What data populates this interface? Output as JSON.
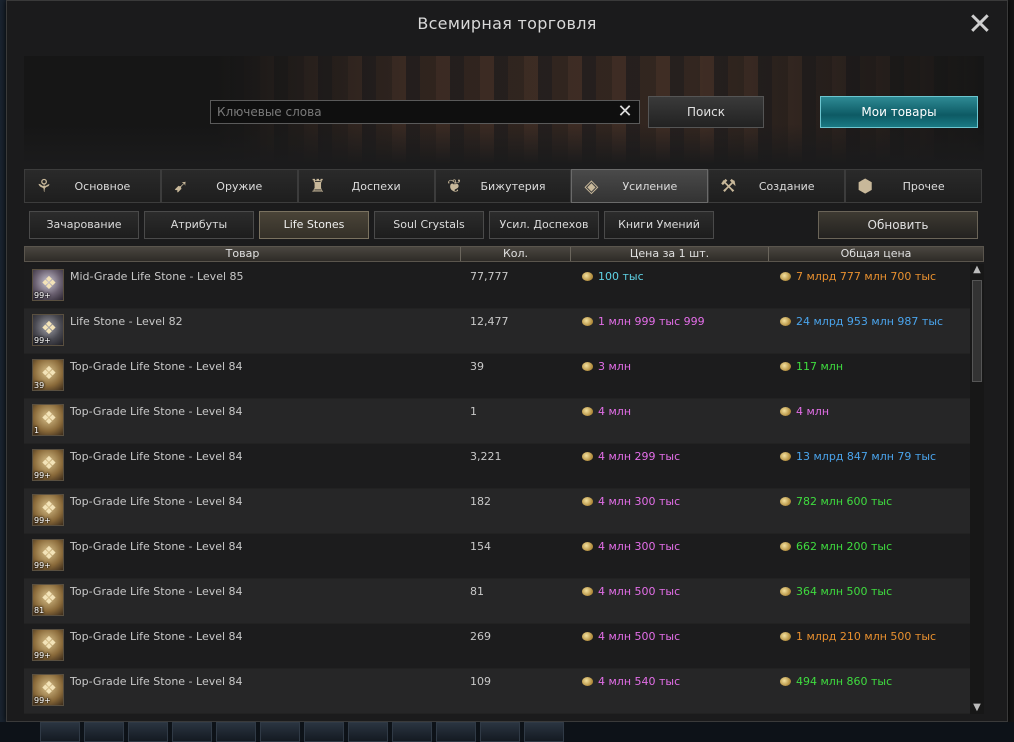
{
  "window": {
    "title": "Всемирная торговля"
  },
  "search": {
    "placeholder": "Ключевые слова",
    "button": "Поиск",
    "my_items": "Мои товары"
  },
  "categories": [
    {
      "label": "Основное",
      "icon": "basic-icon",
      "glyph": "⚘"
    },
    {
      "label": "Оружие",
      "icon": "crossbow-icon",
      "glyph": "➹"
    },
    {
      "label": "Доспехи",
      "icon": "armor-icon",
      "glyph": "♜"
    },
    {
      "label": "Бижутерия",
      "icon": "jewelry-icon",
      "glyph": "❦"
    },
    {
      "label": "Усиление",
      "icon": "enhancement-icon",
      "glyph": "◈",
      "active": true
    },
    {
      "label": "Создание",
      "icon": "crafting-icon",
      "glyph": "⚒"
    },
    {
      "label": "Прочее",
      "icon": "misc-icon",
      "glyph": "⬢"
    }
  ],
  "subcategories": [
    {
      "label": "Зачарование"
    },
    {
      "label": "Атрибуты"
    },
    {
      "label": "Life Stones",
      "active": true
    },
    {
      "label": "Soul Crystals"
    },
    {
      "label": "Усил. Доспехов"
    },
    {
      "label": "Книги Умений"
    }
  ],
  "refresh_label": "Обновить",
  "table": {
    "headers": [
      "Товар",
      "Кол.",
      "Цена за 1 шт.",
      "Общая цена"
    ],
    "colors": {
      "cyan": "#5fd3e6",
      "pink": "#e36ee8",
      "green": "#3fdc3f",
      "blue": "#4aa4ec",
      "orange": "#e8902f"
    },
    "rows": [
      {
        "name": "Mid-Grade Life Stone - Level 85",
        "count_badge": "99+",
        "icon": "mid",
        "qty": "77,777",
        "unit": "100 тыс",
        "unit_color": "cyan",
        "total": "7 млрд 777 млн 700 тыс",
        "total_color": "orange"
      },
      {
        "name": "Life Stone - Level 82",
        "count_badge": "99+",
        "icon": "low",
        "qty": "12,477",
        "unit": "1 млн 999 тыс 999",
        "unit_color": "pink",
        "total": "24 млрд 953 млн 987 тыс",
        "total_color": "blue"
      },
      {
        "name": "Top-Grade Life Stone - Level 84",
        "count_badge": "39",
        "icon": "top",
        "qty": "39",
        "unit": "3 млн",
        "unit_color": "pink",
        "total": "117 млн",
        "total_color": "green"
      },
      {
        "name": "Top-Grade Life Stone - Level 84",
        "count_badge": "1",
        "icon": "top",
        "qty": "1",
        "unit": "4 млн",
        "unit_color": "pink",
        "total": "4 млн",
        "total_color": "pink"
      },
      {
        "name": "Top-Grade Life Stone - Level 84",
        "count_badge": "99+",
        "icon": "top",
        "qty": "3,221",
        "unit": "4 млн 299 тыс",
        "unit_color": "pink",
        "total": "13 млрд 847 млн 79 тыс",
        "total_color": "blue"
      },
      {
        "name": "Top-Grade Life Stone - Level 84",
        "count_badge": "99+",
        "icon": "top",
        "qty": "182",
        "unit": "4 млн 300 тыс",
        "unit_color": "pink",
        "total": "782 млн 600 тыс",
        "total_color": "green"
      },
      {
        "name": "Top-Grade Life Stone - Level 84",
        "count_badge": "99+",
        "icon": "top",
        "qty": "154",
        "unit": "4 млн 300 тыс",
        "unit_color": "pink",
        "total": "662 млн 200 тыс",
        "total_color": "green"
      },
      {
        "name": "Top-Grade Life Stone - Level 84",
        "count_badge": "81",
        "icon": "top",
        "qty": "81",
        "unit": "4 млн 500 тыс",
        "unit_color": "pink",
        "total": "364 млн 500 тыс",
        "total_color": "green"
      },
      {
        "name": "Top-Grade Life Stone - Level 84",
        "count_badge": "99+",
        "icon": "top",
        "qty": "269",
        "unit": "4 млн 500 тыс",
        "unit_color": "pink",
        "total": "1 млрд 210 млн 500 тыс",
        "total_color": "orange"
      },
      {
        "name": "Top-Grade Life Stone - Level 84",
        "count_badge": "99+",
        "icon": "top",
        "qty": "109",
        "unit": "4 млн 540 тыс",
        "unit_color": "pink",
        "total": "494 млн 860 тыс",
        "total_color": "green"
      }
    ]
  }
}
